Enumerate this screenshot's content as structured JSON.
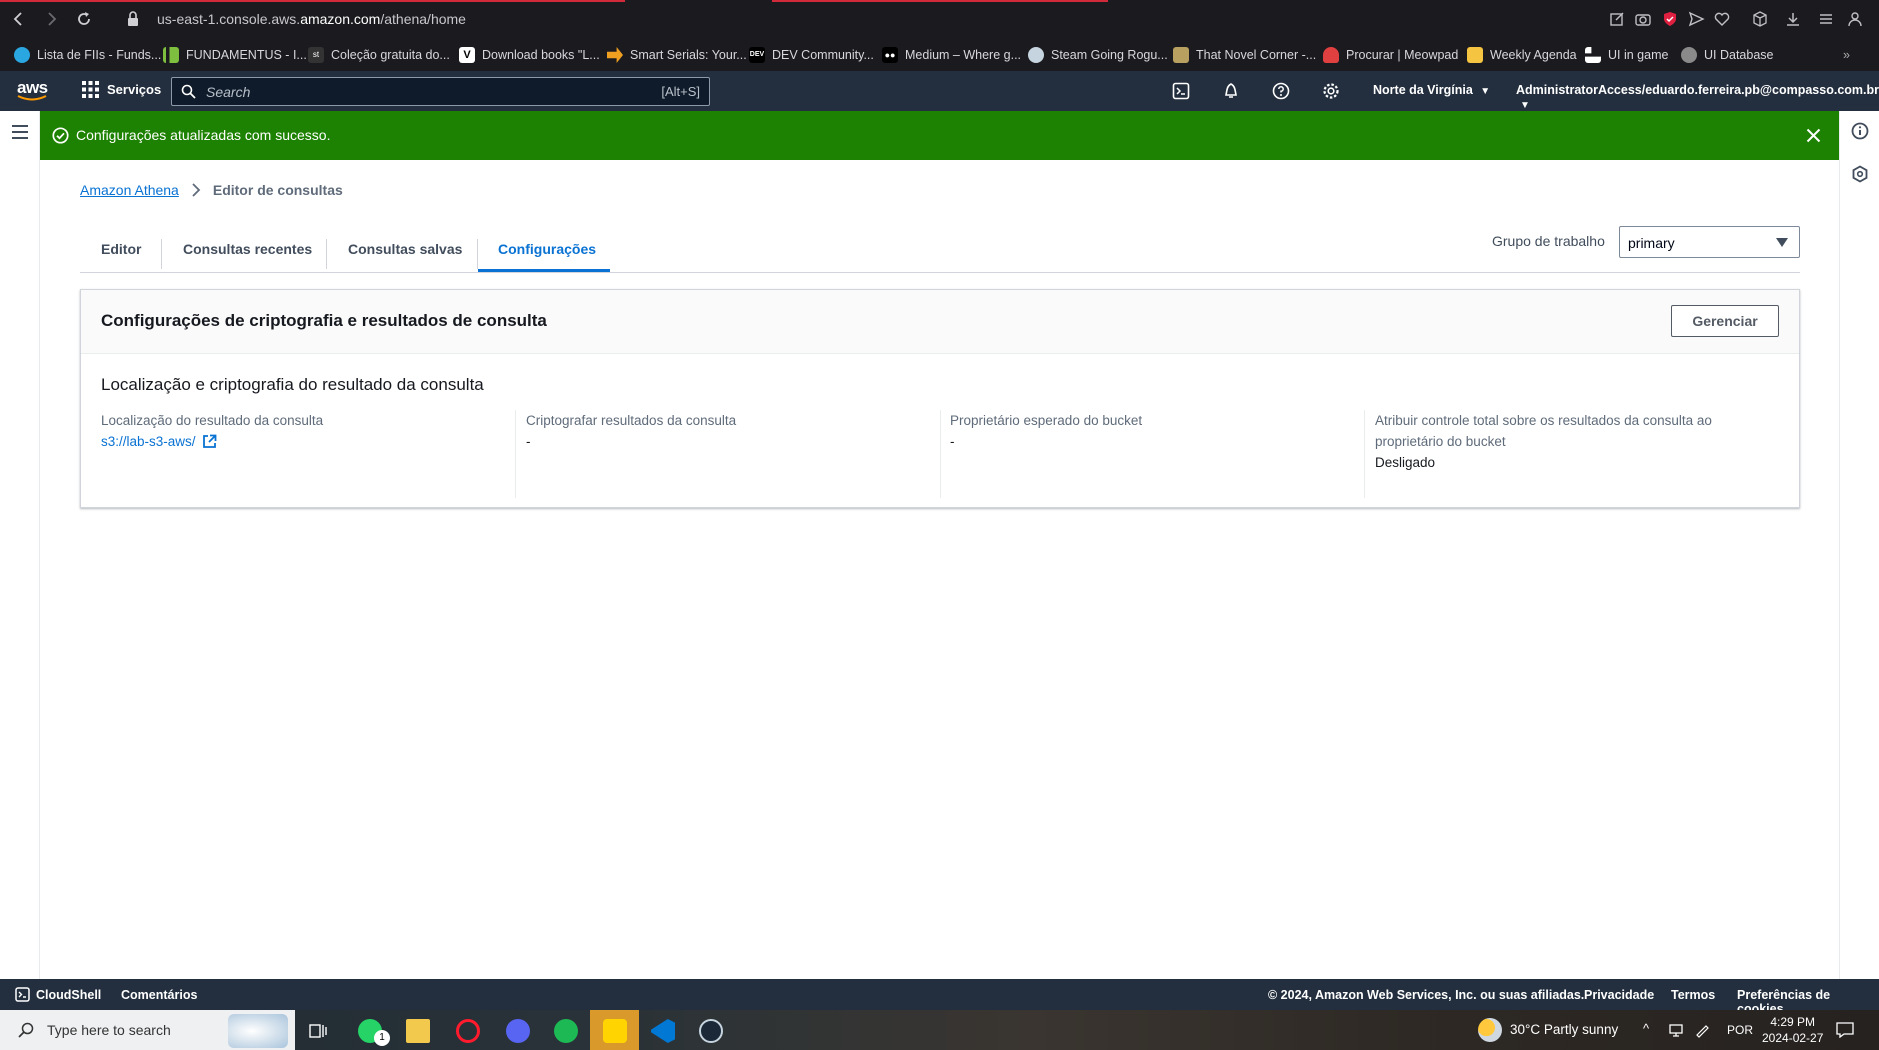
{
  "browser": {
    "url_prefix": "us-east-1.console.aws.",
    "url_domain": "amazon.com",
    "url_path": "/athena/home",
    "bookmarks": [
      {
        "label": "Lista de FIIs - Funds...",
        "color": "#2aa6e0"
      },
      {
        "label": "FUNDAMENTUS - I...",
        "color": "#7fbf3f"
      },
      {
        "label": "Coleção gratuita do...",
        "color": "#333333"
      },
      {
        "label": "Download books \"L...",
        "color": "#ffffff"
      },
      {
        "label": "Smart Serials: Your...",
        "color": "#f0a020"
      },
      {
        "label": "DEV Community...",
        "color": "#000000"
      },
      {
        "label": "Medium – Where g...",
        "color": "#000000"
      },
      {
        "label": "Steam Going Rogu...",
        "color": "#c6d4df"
      },
      {
        "label": "That Novel Corner -...",
        "color": "#b8a060"
      },
      {
        "label": "Procurar | Meowpad",
        "color": "#e04040"
      },
      {
        "label": "Weekly Agenda",
        "color": "#f5c542"
      },
      {
        "label": "UI in game",
        "color": "#ffffff"
      },
      {
        "label": "UI Database",
        "color": "#8a8a8a"
      }
    ]
  },
  "header": {
    "logo": "aws",
    "services_label": "Serviços",
    "search_placeholder": "Search",
    "search_shortcut": "[Alt+S]",
    "region": "Norte da Virgínia",
    "account": "AdministratorAccess/eduardo.ferreira.pb@compasso.com.br"
  },
  "flash": {
    "message": "Configurações atualizadas com sucesso.",
    "color": "#1d8102"
  },
  "breadcrumb": {
    "root": "Amazon Athena",
    "current": "Editor de consultas"
  },
  "tabs": [
    {
      "label": "Editor",
      "active": false
    },
    {
      "label": "Consultas recentes",
      "active": false
    },
    {
      "label": "Consultas salvas",
      "active": false
    },
    {
      "label": "Configurações",
      "active": true
    }
  ],
  "workgroup": {
    "label": "Grupo de trabalho",
    "value": "primary"
  },
  "panel": {
    "title": "Configurações de criptografia e resultados de consulta",
    "manage_button": "Gerenciar",
    "section_title": "Localização e criptografia do resultado da consulta",
    "columns": [
      {
        "label": "Localização do resultado da consulta",
        "value": "s3://lab-s3-aws/"
      },
      {
        "label": "Criptografar resultados da consulta",
        "value": "-"
      },
      {
        "label": "Proprietário esperado do bucket",
        "value": "-"
      },
      {
        "label": "Atribuir controle total sobre os resultados da consulta ao proprietário do bucket",
        "value": "Desligado"
      }
    ]
  },
  "footer": {
    "cloudshell": "CloudShell",
    "feedback": "Comentários",
    "copyright": "© 2024, Amazon Web Services, Inc. ou suas afiliadas.",
    "privacy": "Privacidade",
    "terms": "Termos",
    "cookies": "Preferências de cookies"
  },
  "taskbar": {
    "search_placeholder": "Type here to search",
    "whatsapp_badge": "1",
    "weather": "30°C  Partly sunny",
    "language": "POR",
    "time": "4:29 PM",
    "date": "2024-02-27"
  },
  "colors": {
    "accent": "#0972d3",
    "aws_nav": "#232f3e",
    "success": "#1d8102"
  }
}
